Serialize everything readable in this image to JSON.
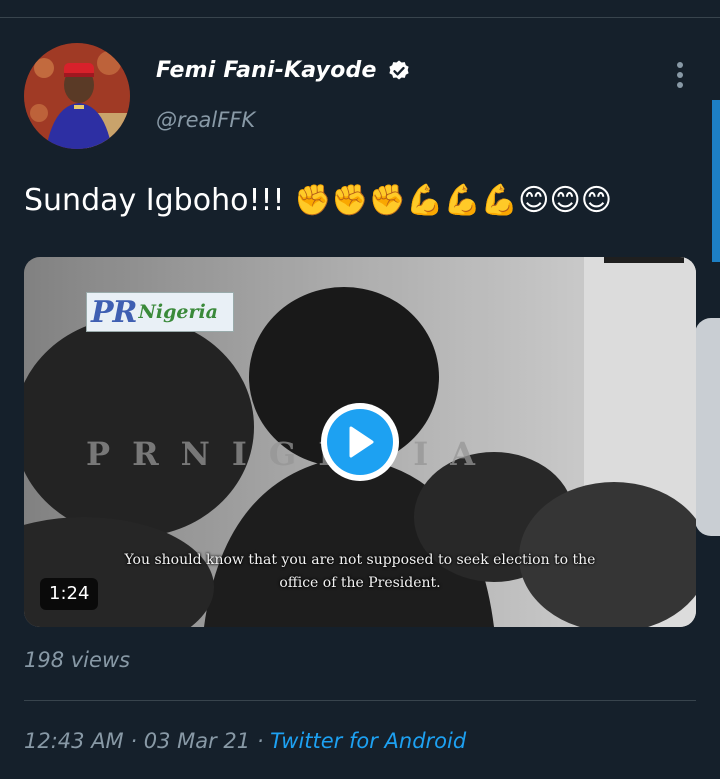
{
  "tweet": {
    "author": {
      "display_name": "Femi Fani-Kayode",
      "handle": "@realFFK",
      "verified": true
    },
    "text": "Sunday Igboho!!! ✊✊✊💪💪💪😊😊😊",
    "media": {
      "logo": {
        "pr": "PR",
        "name": "Nigeria"
      },
      "watermark": "PRNIGERIA",
      "subtitle_line1": "You should know that you are not supposed to seek election to the",
      "subtitle_line2": "office of the President.",
      "duration": "1:24"
    },
    "views": "198 views",
    "time": "12:43 AM",
    "date": "03 Mar 21",
    "separator": " · ",
    "source": "Twitter for Android"
  },
  "icons": {
    "verified": "verified-badge-icon",
    "more": "more-vertical-icon",
    "play": "play-icon"
  },
  "colors": {
    "background": "#15202b",
    "accent": "#1da1f2",
    "secondary_text": "#8899a6",
    "divider": "#38444d"
  }
}
